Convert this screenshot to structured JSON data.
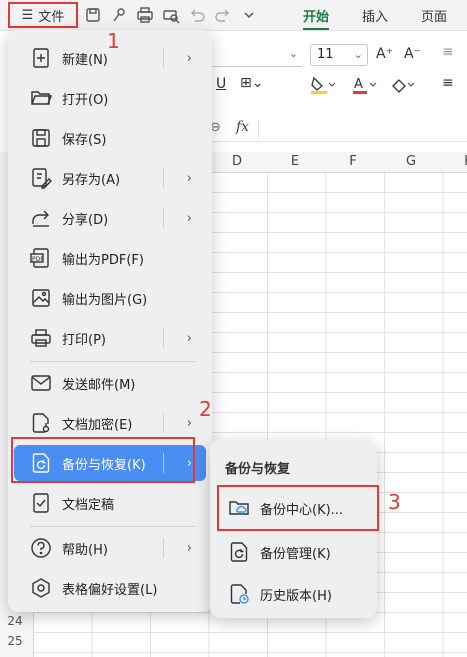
{
  "toolbar": {
    "file_menu_label": "文件",
    "tabs": [
      {
        "label": "开始",
        "active": true
      },
      {
        "label": "插入",
        "active": false
      },
      {
        "label": "页面",
        "active": false
      }
    ]
  },
  "formatting": {
    "font_size": "11",
    "formula_label": "fx"
  },
  "grid": {
    "columns": [
      "D",
      "E",
      "F",
      "G",
      "H"
    ],
    "rows": [
      "24",
      "25"
    ]
  },
  "file_menu": {
    "items": [
      {
        "label": "新建(N)",
        "icon": "new-doc-icon",
        "submenu": true
      },
      {
        "label": "打开(O)",
        "icon": "folder-open-icon",
        "submenu": false
      },
      {
        "label": "保存(S)",
        "icon": "save-icon",
        "submenu": false
      },
      {
        "label": "另存为(A)",
        "icon": "save-as-icon",
        "submenu": true
      },
      {
        "label": "分享(D)",
        "icon": "share-icon",
        "submenu": true
      },
      {
        "label": "输出为PDF(F)",
        "icon": "export-pdf-icon",
        "submenu": false
      },
      {
        "label": "输出为图片(G)",
        "icon": "export-image-icon",
        "submenu": false
      },
      {
        "label": "打印(P)",
        "icon": "print-icon",
        "submenu": true
      },
      {
        "label": "发送邮件(M)",
        "icon": "mail-icon",
        "submenu": false
      },
      {
        "label": "文档加密(E)",
        "icon": "lock-doc-icon",
        "submenu": true
      },
      {
        "label": "备份与恢复(K)",
        "icon": "backup-icon",
        "submenu": true,
        "active": true
      },
      {
        "label": "文档定稿",
        "icon": "finalize-icon",
        "submenu": false
      },
      {
        "label": "帮助(H)",
        "icon": "help-icon",
        "submenu": true
      },
      {
        "label": "表格偏好设置(L)",
        "icon": "settings-icon",
        "submenu": false
      }
    ]
  },
  "submenu": {
    "title": "备份与恢复",
    "items": [
      {
        "label": "备份中心(K)...",
        "icon": "cloud-folder-icon"
      },
      {
        "label": "备份管理(K)",
        "icon": "backup-manage-icon"
      },
      {
        "label": "历史版本(H)",
        "icon": "history-icon"
      }
    ]
  },
  "annotations": {
    "step1": "1",
    "step2": "2",
    "step3": "3"
  },
  "colors": {
    "accent": "#4a8df3",
    "highlight": "#e53935",
    "ribbon_active": "#1f7a4a"
  }
}
